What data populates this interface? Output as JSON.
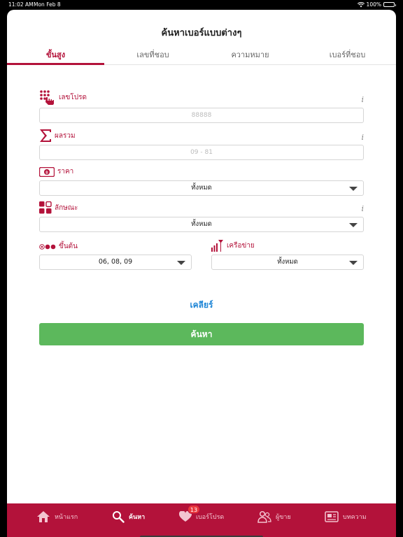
{
  "status": {
    "time": "11:02 AM",
    "date": "Mon Feb 8",
    "battery": "100%"
  },
  "page": {
    "title": "ค้นหาเบอร์แบบต่างๆ"
  },
  "tabs": [
    {
      "label": "ขั้นสูง",
      "active": true
    },
    {
      "label": "เลขที่ชอบ",
      "active": false
    },
    {
      "label": "ความหมาย",
      "active": false
    },
    {
      "label": "เบอร์ที่ชอบ",
      "active": false
    }
  ],
  "fields": {
    "favorite_number": {
      "label": "เลขโปรด",
      "placeholder": "88888",
      "info": "i"
    },
    "sum": {
      "label": "ผลรวม",
      "placeholder": "09 - 81",
      "info": "i"
    },
    "price": {
      "label": "ราคา",
      "value": "ทั้งหมด"
    },
    "pattern": {
      "label": "ลักษณะ",
      "value": "ทั้งหมด",
      "info": "i"
    },
    "prefix": {
      "label": "ขึ้นต้น",
      "value": "06, 08, 09"
    },
    "network": {
      "label": "เครือข่าย",
      "value": "ทั้งหมด"
    }
  },
  "actions": {
    "clear": "เคลียร์",
    "search": "ค้นหา"
  },
  "bottom_nav": [
    {
      "label": "หน้าแรก",
      "icon": "home-icon",
      "active": false
    },
    {
      "label": "ค้นหา",
      "icon": "search-icon",
      "active": true
    },
    {
      "label": "เบอร์โปรด",
      "icon": "heart-icon",
      "active": false,
      "badge": "13"
    },
    {
      "label": "ผู้ขาย",
      "icon": "sellers-icon",
      "active": false
    },
    {
      "label": "บทความ",
      "icon": "article-icon",
      "active": false
    }
  ],
  "colors": {
    "brand": "#b3123a",
    "search_button": "#5cb85c",
    "link": "#1f86d6"
  }
}
